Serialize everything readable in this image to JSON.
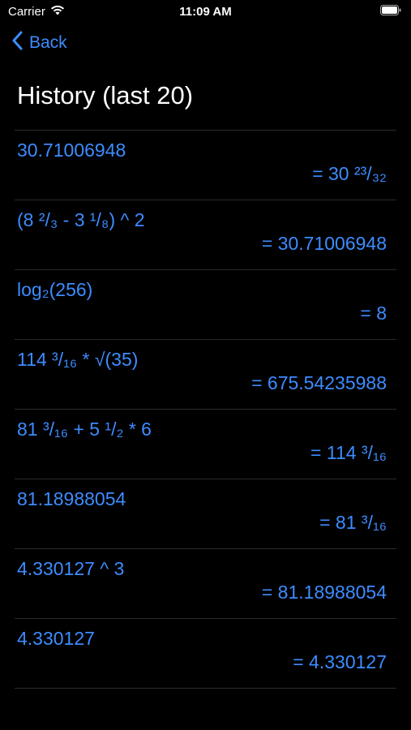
{
  "status_bar": {
    "carrier": "Carrier",
    "time": "11:09 AM",
    "icons": [
      "wifi-icon",
      "battery-icon"
    ]
  },
  "nav": {
    "back_label": "Back",
    "back_icon": "chevron-left-icon"
  },
  "page": {
    "title": "History (last 20)"
  },
  "colors": {
    "accent": "#3d8cff",
    "background": "#000000",
    "separator": "#2a2a2a",
    "title": "#ffffff"
  },
  "history": [
    {
      "expression": "30.71006948",
      "result": "= 30 ²³/₃₂"
    },
    {
      "expression": "(8 ²/₃ - 3 ¹/₈) ^ 2",
      "result": "= 30.71006948"
    },
    {
      "expression": "log₂(256)",
      "result": "= 8"
    },
    {
      "expression": "114 ³/₁₆ * √(35)",
      "result": "= 675.54235988"
    },
    {
      "expression": "81 ³/₁₆ + 5 ¹/₂ * 6",
      "result": "= 114 ³/₁₆"
    },
    {
      "expression": "81.18988054",
      "result": "= 81 ³/₁₆"
    },
    {
      "expression": "4.330127 ^ 3",
      "result": "= 81.18988054"
    },
    {
      "expression": "4.330127",
      "result": "= 4.330127"
    }
  ]
}
